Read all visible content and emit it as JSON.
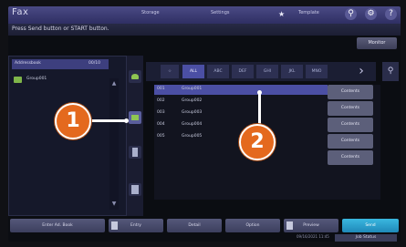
{
  "app": {
    "title": "Fax",
    "tabs": [
      "Storage",
      "Settings",
      "Template"
    ],
    "home_label": "★",
    "message": "Press Send button or START button."
  },
  "monitor_label": "Monitor",
  "left_panel": {
    "header_title": "Addressbook",
    "header_count": "00/10",
    "group_label": "Group001"
  },
  "tabs": [
    "ALL",
    "ABC",
    "DEF",
    "GHI",
    "JKL",
    "MNO"
  ],
  "list_rows": [
    {
      "num": "001",
      "name": "Group001",
      "selected": true
    },
    {
      "num": "002",
      "name": "Group002",
      "selected": false
    },
    {
      "num": "003",
      "name": "Group003",
      "selected": false
    },
    {
      "num": "004",
      "name": "Group004",
      "selected": false
    },
    {
      "num": "005",
      "name": "Group005",
      "selected": false
    }
  ],
  "contents_label": "Contents",
  "bottom_buttons": {
    "enter_label": "Enter Ad. Book",
    "b2": "Entry",
    "b3": "Detail",
    "b4": "Option",
    "b5": "Preview",
    "send": "Send"
  },
  "footer_text": "09/16/2021 11:45",
  "job_status_label": "Job Status",
  "callouts": [
    "1",
    "2"
  ],
  "colors": {
    "accent": "#4b4fa4",
    "callout": "#e4691e",
    "send": "#2aa6d4"
  }
}
